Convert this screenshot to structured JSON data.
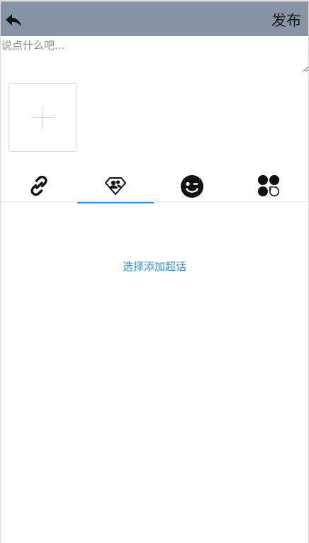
{
  "header": {
    "back_icon": "reply-arrow-icon",
    "publish_label": "发布",
    "background": "#8894a6"
  },
  "composer": {
    "placeholder": "说点什么吧...",
    "value": ""
  },
  "media": {
    "add_icon": "plus-icon"
  },
  "tabs": [
    {
      "id": "link",
      "icon": "link-icon",
      "active": false
    },
    {
      "id": "supertopic",
      "icon": "diamond-people-icon",
      "active": true
    },
    {
      "id": "emoji",
      "icon": "wink-emoji-icon",
      "active": false
    },
    {
      "id": "more",
      "icon": "apps-grid-icon",
      "active": false
    }
  ],
  "topic_panel": {
    "select_label": "选择添加超话",
    "accent": "#2a90d8"
  }
}
